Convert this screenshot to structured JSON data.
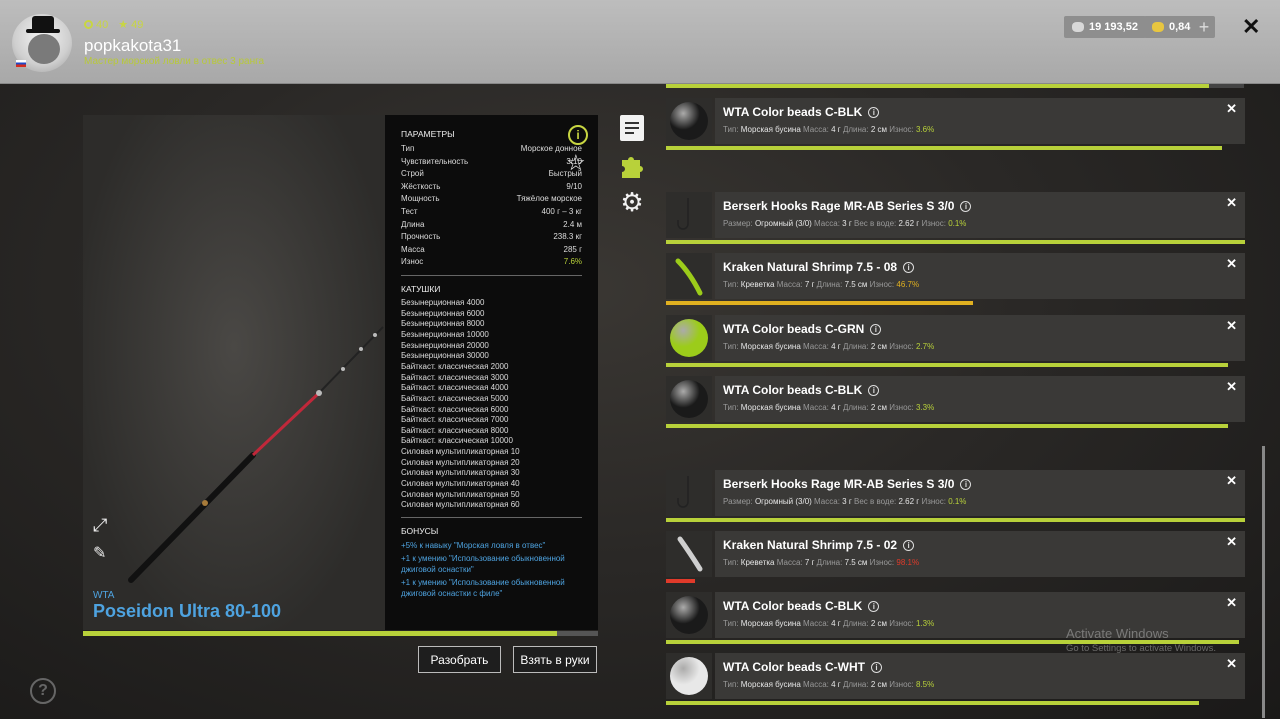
{
  "player": {
    "stat_level": "40",
    "stat_stars": "49",
    "username": "popkakota31",
    "rank": "Мастер морской ловли в отвес 3 ранга"
  },
  "currency": {
    "silver": "19 193,52",
    "gold": "0,84",
    "silver_color": "#d8d8d8",
    "gold_color": "#e8c640"
  },
  "rod": {
    "brand": "WTA",
    "name": "Poseidon Ultra 80-100",
    "wear_fraction": 0.92
  },
  "params": {
    "heading": "ПАРАМЕТРЫ",
    "rows": [
      {
        "label": "Тип",
        "value": "Морское донное"
      },
      {
        "label": "Чувствительность",
        "value": "3/10"
      },
      {
        "label": "Строй",
        "value": "Быстрый"
      },
      {
        "label": "Жёсткость",
        "value": "9/10"
      },
      {
        "label": "Мощность",
        "value": "Тяжёлое морское"
      },
      {
        "label": "Тест",
        "value": "400 г – 3 кг"
      },
      {
        "label": "Длина",
        "value": "2.4 м"
      },
      {
        "label": "Прочность",
        "value": "238.3 кг"
      },
      {
        "label": "Масса",
        "value": "285 г"
      },
      {
        "label": "Износ",
        "value": "7.6%"
      }
    ],
    "reels_heading": "КАТУШКИ",
    "reels": [
      "Безынерционная 4000",
      "Безынерционная 6000",
      "Безынерционная 8000",
      "Безынерционная 10000",
      "Безынерционная 20000",
      "Безынерционная 30000",
      "Байткаст. классическая 2000",
      "Байткаст. классическая 3000",
      "Байткаст. классическая 4000",
      "Байткаст. классическая 5000",
      "Байткаст. классическая 6000",
      "Байткаст. классическая 7000",
      "Байткаст. классическая 8000",
      "Байткаст. классическая 10000",
      "Силовая мультипликаторная 10",
      "Силовая мультипликаторная 20",
      "Силовая мультипликаторная 30",
      "Силовая мультипликаторная 40",
      "Силовая мультипликаторная 50",
      "Силовая мультипликаторная 60"
    ],
    "bonuses_heading": "БОНУСЫ",
    "bonuses": [
      "+5% к навыку \"Морская ловля в отвес\"",
      "+1 к умению \"Использование обыкновенной джиговой оснастки\"",
      "+1 к умению \"Использование обыкновенной джиговой оснастки с филе\""
    ]
  },
  "buttons": {
    "disassemble": "Разобрать",
    "take": "Взять в руки"
  },
  "items": [
    {
      "title": "WTA Color beads C-BLK",
      "kind": "bead",
      "color": "#1a1a1a",
      "meta": [
        [
          "Тип:",
          "Морская бусина"
        ],
        [
          "Масса:",
          "4 г"
        ],
        [
          "Длина:",
          "2 см"
        ],
        [
          "Износ:",
          "3.6%"
        ]
      ],
      "wear_class": "wg",
      "bar": 0.96,
      "bar_class": ""
    },
    {
      "title": "Berserk Hooks Rage MR-AB Series S 3/0",
      "kind": "hook",
      "meta": [
        [
          "Размер:",
          "Огромный (3/0)"
        ],
        [
          "Масса:",
          "3 г"
        ],
        [
          "Вес в воде:",
          "2.62 г"
        ],
        [
          "Износ:",
          "0.1%"
        ]
      ],
      "wear_class": "wg",
      "bar": 1.0,
      "bar_class": ""
    },
    {
      "title": "Kraken Natural Shrimp 7.5 - 08",
      "kind": "shrimp-green",
      "meta": [
        [
          "Тип:",
          "Креветка"
        ],
        [
          "Масса:",
          "7 г"
        ],
        [
          "Длина:",
          "7.5 см"
        ],
        [
          "Износ:",
          "46.7%"
        ]
      ],
      "wear_class": "wy",
      "bar": 0.53,
      "bar_class": "yellow"
    },
    {
      "title": "WTA Color beads C-GRN",
      "kind": "bead",
      "color": "#9ccc1a",
      "meta": [
        [
          "Тип:",
          "Морская бусина"
        ],
        [
          "Масса:",
          "4 г"
        ],
        [
          "Длина:",
          "2 см"
        ],
        [
          "Износ:",
          "2.7%"
        ]
      ],
      "wear_class": "wg",
      "bar": 0.97,
      "bar_class": ""
    },
    {
      "title": "WTA Color beads C-BLK",
      "kind": "bead",
      "color": "#1a1a1a",
      "meta": [
        [
          "Тип:",
          "Морская бусина"
        ],
        [
          "Масса:",
          "4 г"
        ],
        [
          "Длина:",
          "2 см"
        ],
        [
          "Износ:",
          "3.3%"
        ]
      ],
      "wear_class": "wg",
      "bar": 0.97,
      "bar_class": ""
    },
    {
      "title": "Berserk Hooks Rage MR-AB Series S 3/0",
      "kind": "hook",
      "meta": [
        [
          "Размер:",
          "Огромный (3/0)"
        ],
        [
          "Масса:",
          "3 г"
        ],
        [
          "Вес в воде:",
          "2.62 г"
        ],
        [
          "Износ:",
          "0.1%"
        ]
      ],
      "wear_class": "wg",
      "bar": 1.0,
      "bar_class": ""
    },
    {
      "title": "Kraken Natural Shrimp 7.5 - 02",
      "kind": "shrimp-white",
      "meta": [
        [
          "Тип:",
          "Креветка"
        ],
        [
          "Масса:",
          "7 г"
        ],
        [
          "Длина:",
          "7.5 см"
        ],
        [
          "Износ:",
          "98.1%"
        ]
      ],
      "wear_class": "wr",
      "bar": 0.05,
      "bar_class": "red"
    },
    {
      "title": "WTA Color beads C-BLK",
      "kind": "bead",
      "color": "#1a1a1a",
      "meta": [
        [
          "Тип:",
          "Морская бусина"
        ],
        [
          "Масса:",
          "4 г"
        ],
        [
          "Длина:",
          "2 см"
        ],
        [
          "Износ:",
          "1.3%"
        ]
      ],
      "wear_class": "wg",
      "bar": 0.99,
      "bar_class": ""
    },
    {
      "title": "WTA Color beads C-WHT",
      "kind": "bead",
      "color": "#e8e8e8",
      "meta": [
        [
          "Тип:",
          "Морская бусина"
        ],
        [
          "Масса:",
          "4 г"
        ],
        [
          "Длина:",
          "2 см"
        ],
        [
          "Износ:",
          "8.5%"
        ]
      ],
      "wear_class": "wg",
      "bar": 0.92,
      "bar_class": ""
    }
  ],
  "watermark": {
    "line1": "Activate Windows",
    "line2": "Go to Settings to activate Windows."
  },
  "help": "?"
}
